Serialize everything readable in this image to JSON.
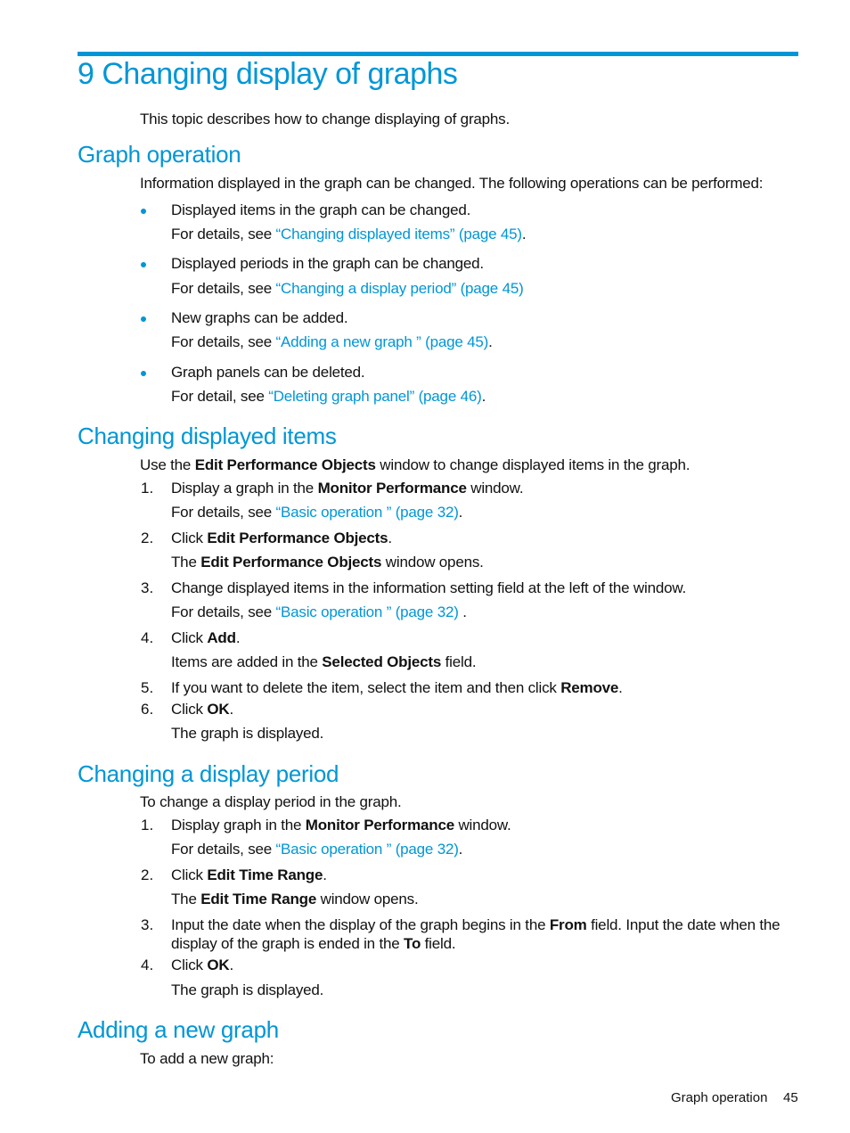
{
  "chapter_title": "9 Changing display of graphs",
  "intro": "This topic describes how to change displaying of graphs.",
  "graph_operation": {
    "heading": "Graph operation",
    "intro": "Information displayed in the graph can be changed. The following operations can be performed:",
    "bullets": [
      {
        "text": "Displayed items in the graph can be changed.",
        "see_prefix": "For details, see ",
        "link": "“Changing displayed items” (page 45)",
        "suffix": "."
      },
      {
        "text": "Displayed periods in the graph can be changed.",
        "see_prefix": "For details, see ",
        "link": "“Changing a display period” (page 45)",
        "suffix": ""
      },
      {
        "text": "New graphs can be added.",
        "see_prefix": "For details, see ",
        "link": "“Adding a new graph ” (page 45)",
        "suffix": "."
      },
      {
        "text": "Graph panels can be deleted.",
        "see_prefix": "For detail, see ",
        "link": "“Deleting graph panel” (page 46)",
        "suffix": "."
      }
    ]
  },
  "changing_items": {
    "heading": "Changing displayed items",
    "intro_a": "Use the ",
    "intro_b": "Edit Performance Objects",
    "intro_c": " window to change displayed items in the graph.",
    "steps": [
      {
        "num": "1.",
        "a": "Display a graph in the ",
        "b": "Monitor Performance",
        "c": " window.",
        "sub_prefix": "For details, see ",
        "sub_link": "“Basic operation ” (page 32)",
        "sub_suffix": "."
      },
      {
        "num": "2.",
        "a": "Click ",
        "b": "Edit Performance Objects",
        "c": ".",
        "sub_a": "The ",
        "sub_b": "Edit Performance Objects",
        "sub_c": " window opens."
      },
      {
        "num": "3.",
        "a": "Change displayed items in the information setting field at the left of the window.",
        "sub_prefix": "For details, see ",
        "sub_link": "“Basic operation ” (page 32)",
        "sub_suffix": " ."
      },
      {
        "num": "4.",
        "a": "Click ",
        "b": "Add",
        "c": ".",
        "sub_a": "Items are added in the ",
        "sub_b": "Selected Objects",
        "sub_c": " field."
      },
      {
        "num": "5.",
        "a": "If you want to delete the item, select the item and then click ",
        "b": "Remove",
        "c": "."
      },
      {
        "num": "6.",
        "a": "Click ",
        "b": "OK",
        "c": ".",
        "sub": "The graph is displayed."
      }
    ]
  },
  "changing_period": {
    "heading": "Changing a display period",
    "intro": "To change a display period in the graph.",
    "steps": [
      {
        "num": "1.",
        "a": "Display graph in the ",
        "b": "Monitor Performance",
        "c": " window.",
        "sub_prefix": "For details, see ",
        "sub_link": "“Basic operation ” (page 32)",
        "sub_suffix": "."
      },
      {
        "num": "2.",
        "a": "Click ",
        "b": "Edit Time Range",
        "c": ".",
        "sub_a": "The ",
        "sub_b": "Edit Time Range",
        "sub_c": " window opens."
      },
      {
        "num": "3.",
        "a": "Input the date when the display of the graph begins in the ",
        "b": "From",
        "c": " field. Input the date when the",
        "a2": "display of the graph is ended in the ",
        "b2": "To",
        "c2": " field."
      },
      {
        "num": "4.",
        "a": "Click ",
        "b": "OK",
        "c": ".",
        "sub": "The graph is displayed."
      }
    ]
  },
  "adding_graph": {
    "heading": "Adding a new graph",
    "intro": "To add a new graph:"
  },
  "footer": {
    "section": "Graph operation",
    "page": "45"
  },
  "colors": {
    "accent": "#0096d6",
    "text": "#111111"
  }
}
